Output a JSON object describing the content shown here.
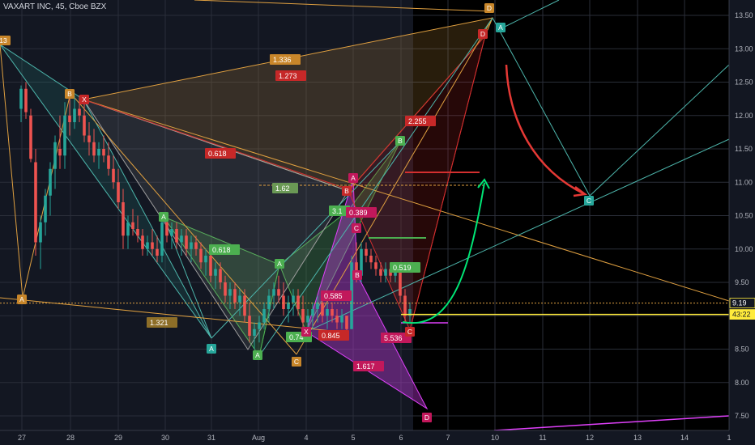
{
  "header": {
    "symbol_line": "VAXART INC, 45, Cboe BZX"
  },
  "colors": {
    "background": "#131722",
    "grid": "#2a2e39",
    "up": "#26a69a",
    "down": "#ef5350",
    "orange": "#e0a040",
    "green": "#4caf50",
    "red": "#d32f2f",
    "magenta": "#e040fb",
    "teal": "#26a69a",
    "yellow": "#ffeb3b"
  },
  "chart_data": {
    "type": "candlestick",
    "y_ticks": [
      "13.50",
      "13.00",
      "12.50",
      "12.00",
      "11.50",
      "11.00",
      "10.50",
      "10.00",
      "9.50",
      "9.00",
      "8.50",
      "8.00",
      "7.50"
    ],
    "x_ticks": [
      "27",
      "28",
      "29",
      "30",
      "31",
      "Aug",
      "4",
      "5",
      "6",
      "7",
      "10",
      "11",
      "12",
      "13",
      "14",
      "1"
    ],
    "ylim": [
      7.3,
      13.75
    ],
    "price_labels": [
      {
        "text": "9.19",
        "value": 9.19,
        "color": "#ffffff",
        "bg": "#131722"
      },
      {
        "text": "43:22",
        "value": 9.02,
        "color": "#131722",
        "bg": "#ffeb3b"
      }
    ],
    "ratio_labels": [
      "1.336",
      "1.273",
      "0.618",
      "2.255",
      "1.62",
      "3.1",
      "0.389",
      "0.618",
      "0.585",
      "0.519",
      "1.321",
      "0.74",
      "0.845",
      "5.536",
      "1.617"
    ],
    "point_labels": [
      "D",
      "B",
      "D",
      "X",
      "B",
      "A",
      "A",
      "C",
      "A",
      "B",
      "C",
      "D",
      "A",
      "B",
      "C",
      "X",
      "A",
      "A",
      "C",
      "D",
      "C",
      "A",
      "13"
    ],
    "candles": [
      [
        26,
        12.1,
        12.45,
        11.9,
        12.4
      ],
      [
        32,
        12.4,
        12.5,
        11.95,
        12.05
      ],
      [
        38,
        12.0,
        12.1,
        11.3,
        11.35
      ],
      [
        44,
        11.3,
        11.5,
        9.9,
        10.1
      ],
      [
        50,
        10.1,
        10.5,
        9.7,
        10.4
      ],
      [
        56,
        10.4,
        10.9,
        10.2,
        10.8
      ],
      [
        62,
        10.8,
        11.3,
        10.5,
        11.2
      ],
      [
        68,
        11.2,
        11.7,
        10.9,
        11.6
      ],
      [
        74,
        11.5,
        12.0,
        11.2,
        11.4
      ],
      [
        80,
        11.4,
        12.2,
        11.2,
        12.0
      ],
      [
        86,
        12.0,
        12.3,
        11.7,
        11.9
      ],
      [
        92,
        11.9,
        12.3,
        11.8,
        12.1
      ],
      [
        98,
        12.1,
        12.3,
        11.9,
        12.0
      ],
      [
        104,
        12.0,
        12.2,
        11.6,
        11.7
      ],
      [
        110,
        11.7,
        11.9,
        11.4,
        11.6
      ],
      [
        116,
        11.6,
        11.8,
        11.3,
        11.4
      ],
      [
        122,
        11.4,
        11.6,
        11.2,
        11.5
      ],
      [
        128,
        11.5,
        11.7,
        11.3,
        11.4
      ],
      [
        134,
        11.4,
        11.6,
        11.1,
        11.2
      ],
      [
        140,
        11.2,
        11.4,
        10.9,
        11.0
      ],
      [
        146,
        11.0,
        11.2,
        10.6,
        10.7
      ],
      [
        152,
        10.7,
        10.9,
        10.0,
        10.2
      ],
      [
        158,
        10.2,
        10.5,
        10.0,
        10.4
      ],
      [
        164,
        10.4,
        10.6,
        10.2,
        10.3
      ],
      [
        170,
        10.3,
        10.5,
        10.1,
        10.2
      ],
      [
        176,
        10.2,
        10.3,
        9.9,
        10.0
      ],
      [
        182,
        10.0,
        10.2,
        9.9,
        10.1
      ],
      [
        188,
        10.1,
        10.3,
        9.9,
        10.0
      ],
      [
        194,
        10.0,
        10.2,
        9.8,
        9.9
      ],
      [
        200,
        9.9,
        10.5,
        9.8,
        10.4
      ],
      [
        206,
        10.4,
        10.5,
        10.1,
        10.2
      ],
      [
        212,
        10.2,
        10.4,
        10.0,
        10.3
      ],
      [
        218,
        10.3,
        10.4,
        10.0,
        10.1
      ],
      [
        224,
        10.1,
        10.3,
        9.9,
        10.2
      ],
      [
        230,
        10.2,
        10.3,
        9.9,
        10.0
      ],
      [
        236,
        10.0,
        10.2,
        9.8,
        10.1
      ],
      [
        242,
        10.1,
        10.2,
        9.9,
        10.0
      ],
      [
        248,
        10.0,
        10.1,
        9.7,
        9.8
      ],
      [
        254,
        9.8,
        10.0,
        9.6,
        9.9
      ],
      [
        260,
        9.9,
        10.0,
        9.5,
        9.6
      ],
      [
        266,
        9.6,
        9.8,
        9.4,
        9.7
      ],
      [
        272,
        9.7,
        9.8,
        9.4,
        9.5
      ],
      [
        278,
        9.5,
        9.6,
        9.2,
        9.3
      ],
      [
        284,
        9.3,
        9.5,
        9.1,
        9.4
      ],
      [
        290,
        9.4,
        9.5,
        9.1,
        9.2
      ],
      [
        296,
        9.2,
        9.4,
        9.0,
        9.3
      ],
      [
        302,
        9.3,
        9.4,
        8.9,
        9.0
      ],
      [
        308,
        9.0,
        9.2,
        8.6,
        8.7
      ],
      [
        314,
        8.7,
        8.9,
        8.5,
        8.8
      ],
      [
        320,
        8.8,
        9.0,
        8.6,
        8.9
      ],
      [
        326,
        8.9,
        9.2,
        8.8,
        9.1
      ],
      [
        332,
        9.1,
        9.4,
        8.9,
        9.3
      ],
      [
        338,
        9.3,
        9.5,
        9.1,
        9.4
      ],
      [
        344,
        9.4,
        9.6,
        9.2,
        9.3
      ],
      [
        350,
        9.3,
        9.5,
        9.0,
        9.1
      ],
      [
        356,
        9.1,
        9.3,
        8.9,
        9.2
      ],
      [
        362,
        9.2,
        9.4,
        9.0,
        9.3
      ],
      [
        368,
        9.3,
        9.4,
        9.0,
        9.1
      ],
      [
        374,
        9.1,
        9.3,
        8.8,
        8.9
      ],
      [
        380,
        8.9,
        9.1,
        8.7,
        9.0
      ],
      [
        386,
        9.0,
        9.2,
        8.8,
        9.1
      ],
      [
        392,
        9.1,
        9.3,
        8.9,
        9.2
      ],
      [
        398,
        9.2,
        9.3,
        8.9,
        9.0
      ],
      [
        404,
        9.0,
        9.2,
        8.8,
        9.1
      ],
      [
        410,
        9.1,
        9.2,
        8.9,
        9.0
      ],
      [
        416,
        9.0,
        9.1,
        8.8,
        8.9
      ],
      [
        422,
        8.9,
        9.1,
        8.8,
        9.0
      ],
      [
        428,
        9.0,
        9.0,
        8.7,
        8.8
      ],
      [
        434,
        8.8,
        9.9,
        8.8,
        9.8
      ],
      [
        440,
        9.8,
        10.1,
        9.5,
        9.6
      ],
      [
        446,
        9.6,
        10.1,
        9.5,
        10.0
      ],
      [
        452,
        10.0,
        10.1,
        9.8,
        9.9
      ],
      [
        458,
        9.9,
        10.0,
        9.7,
        9.8
      ],
      [
        464,
        9.8,
        9.9,
        9.6,
        9.7
      ],
      [
        470,
        9.7,
        9.8,
        9.5,
        9.6
      ],
      [
        476,
        9.6,
        9.8,
        9.5,
        9.7
      ],
      [
        482,
        9.7,
        9.8,
        9.5,
        9.6
      ],
      [
        488,
        9.6,
        9.8,
        9.5,
        9.7
      ],
      [
        494,
        9.7,
        9.8,
        9.2,
        9.3
      ],
      [
        500,
        9.3,
        9.4,
        8.9,
        9.0
      ],
      [
        506,
        9.0,
        9.2,
        8.9,
        9.1
      ]
    ]
  }
}
